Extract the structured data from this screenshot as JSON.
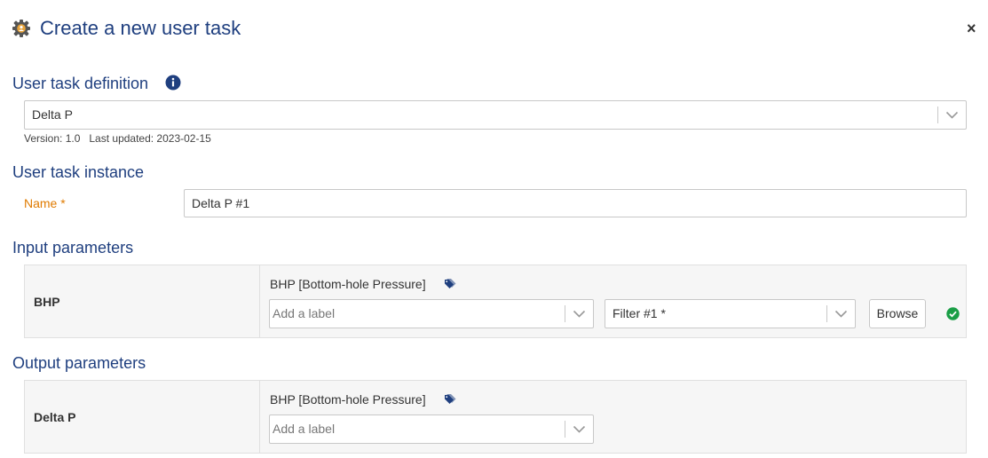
{
  "dialog": {
    "title": "Create a new user task",
    "close_label": "×"
  },
  "definition": {
    "section_title": "User task definition",
    "selected": "Delta P",
    "version": "Version: 1.0",
    "last_updated": "Last updated: 2023-02-15"
  },
  "instance": {
    "section_title": "User task instance",
    "name_label": "Name *",
    "name_value": "Delta P #1"
  },
  "inputs": {
    "section_title": "Input parameters",
    "params": [
      {
        "name": "BHP",
        "variable": "BHP [Bottom-hole Pressure]",
        "label_placeholder": "Add a label",
        "filter": "Filter #1 *",
        "browse_label": "Browse"
      }
    ]
  },
  "outputs": {
    "section_title": "Output parameters",
    "params": [
      {
        "name": "Delta P",
        "variable": "BHP [Bottom-hole Pressure]",
        "label_placeholder": "Add a label"
      }
    ]
  },
  "colors": {
    "heading": "#1f3f7f",
    "required_label": "#e07b00",
    "success": "#1a9e46",
    "tag": "#1f3f7f"
  },
  "icons": {
    "header": "gear-user-icon",
    "info": "info-icon",
    "tag": "tag-icon",
    "status": "check-circle-icon",
    "dropdown": "chevron-down-icon"
  }
}
